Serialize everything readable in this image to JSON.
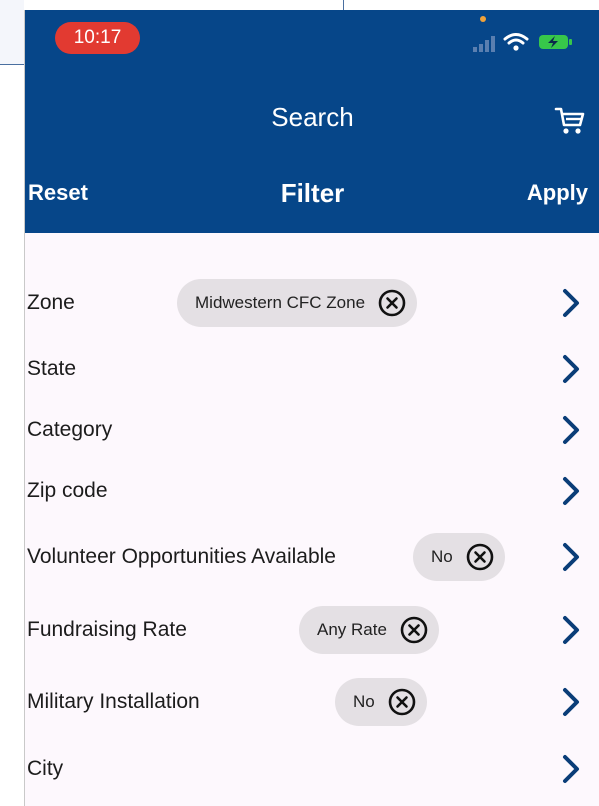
{
  "status_bar": {
    "time": "10:17",
    "time_pill_color": "#e23a31"
  },
  "header": {
    "title": "Search",
    "cart_icon": "cart-icon",
    "reset_label": "Reset",
    "filter_title": "Filter",
    "apply_label": "Apply",
    "background_color": "#064689"
  },
  "filters": [
    {
      "label": "Zone",
      "value": "Midwestern CFC Zone"
    },
    {
      "label": "State",
      "value": null
    },
    {
      "label": "Category",
      "value": null
    },
    {
      "label": "Zip code",
      "value": null
    },
    {
      "label": "Volunteer Opportunities Available",
      "value": "No"
    },
    {
      "label": "Fundraising Rate",
      "value": "Any Rate"
    },
    {
      "label": "Military Installation",
      "value": "No"
    },
    {
      "label": "City",
      "value": null
    }
  ],
  "colors": {
    "accent": "#064689",
    "chevron": "#0a3d78",
    "chip_bg": "#e4e0e4"
  }
}
